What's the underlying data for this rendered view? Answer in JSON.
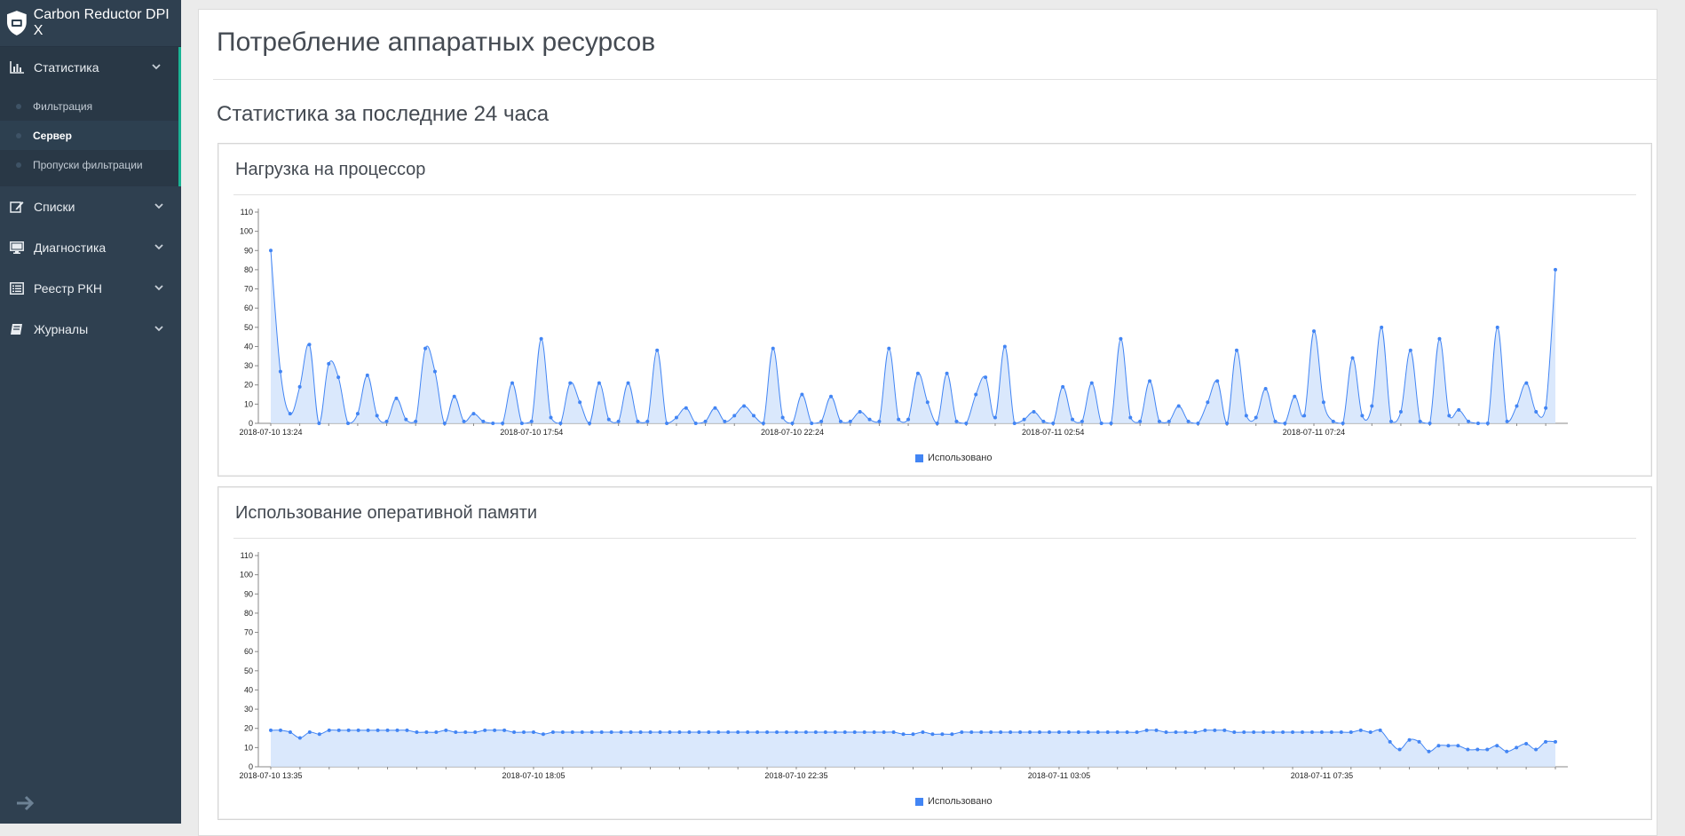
{
  "app": {
    "title": "Carbon Reductor DPI X"
  },
  "sidebar": {
    "items": [
      {
        "label": "Статистика",
        "icon": "bar-chart-icon",
        "expanded": true,
        "children": [
          {
            "label": "Фильтрация"
          },
          {
            "label": "Сервер",
            "current": true
          },
          {
            "label": "Пропуски фильтрации"
          }
        ]
      },
      {
        "label": "Списки",
        "icon": "edit-icon"
      },
      {
        "label": "Диагностика",
        "icon": "monitor-icon"
      },
      {
        "label": "Реестр РКН",
        "icon": "list-icon"
      },
      {
        "label": "Журналы",
        "icon": "book-icon"
      }
    ]
  },
  "page": {
    "title": "Потребление аппаратных ресурсов",
    "section_title": "Статистика за последние 24 часа"
  },
  "colors": {
    "sidebar": "#2f4050",
    "accent": "#1ab394",
    "series": "#4285f4",
    "fill": "#d4e4fb"
  },
  "chart_data": [
    {
      "type": "area",
      "title": "Нагрузка на процессор",
      "ylim": [
        0,
        110
      ],
      "yticks": [
        0,
        10,
        20,
        30,
        40,
        50,
        60,
        70,
        80,
        90,
        100,
        110
      ],
      "xtick_labels": [
        "2018-07-10 13:24",
        "2018-07-10 17:54",
        "2018-07-10 22:24",
        "2018-07-11 02:54",
        "2018-07-11 07:24"
      ],
      "xtick_index": [
        0,
        27,
        54,
        81,
        108
      ],
      "grid": false,
      "legend_position": "bottom",
      "series": [
        {
          "name": "Использовано",
          "values": [
            90,
            27,
            5,
            19,
            41,
            0,
            31,
            24,
            0,
            5,
            25,
            4,
            1,
            13,
            2,
            1,
            39,
            27,
            0,
            14,
            1,
            5,
            1,
            0,
            0,
            21,
            0,
            1,
            44,
            3,
            0,
            21,
            11,
            0,
            21,
            2,
            1,
            21,
            1,
            1,
            38,
            0,
            3,
            8,
            0,
            1,
            8,
            1,
            4,
            9,
            4,
            0,
            39,
            3,
            0,
            15,
            0,
            1,
            14,
            1,
            1,
            6,
            2,
            1,
            39,
            2,
            2,
            26,
            11,
            0,
            26,
            1,
            0,
            15,
            24,
            3,
            40,
            0,
            2,
            6,
            1,
            0,
            19,
            2,
            1,
            21,
            0,
            0,
            44,
            3,
            1,
            22,
            1,
            1,
            9,
            1,
            0,
            11,
            22,
            0,
            38,
            4,
            3,
            18,
            1,
            0,
            14,
            4,
            48,
            11,
            1,
            0,
            34,
            4,
            9,
            50,
            1,
            6,
            38,
            1,
            0,
            44,
            4,
            7,
            1,
            0,
            0,
            50,
            1,
            9,
            21,
            6,
            8,
            80
          ]
        }
      ]
    },
    {
      "type": "area",
      "title": "Использование оперативной памяти",
      "ylim": [
        0,
        110
      ],
      "yticks": [
        0,
        10,
        20,
        30,
        40,
        50,
        60,
        70,
        80,
        90,
        100,
        110
      ],
      "xtick_labels": [
        "2018-07-10 13:35",
        "2018-07-10 18:05",
        "2018-07-10 22:35",
        "2018-07-11 03:05",
        "2018-07-11 07:35"
      ],
      "xtick_index": [
        0,
        27,
        54,
        81,
        108
      ],
      "grid": false,
      "legend_position": "bottom",
      "series": [
        {
          "name": "Использовано",
          "values": [
            19,
            19,
            18,
            15,
            18,
            17,
            19,
            19,
            19,
            19,
            19,
            19,
            19,
            19,
            19,
            18,
            18,
            18,
            19,
            18,
            18,
            18,
            19,
            19,
            19,
            18,
            18,
            18,
            17,
            18,
            18,
            18,
            18,
            18,
            18,
            18,
            18,
            18,
            18,
            18,
            18,
            18,
            18,
            18,
            18,
            18,
            18,
            18,
            18,
            18,
            18,
            18,
            18,
            18,
            18,
            18,
            18,
            18,
            18,
            18,
            18,
            18,
            18,
            18,
            18,
            17,
            17,
            18,
            17,
            17,
            17,
            18,
            18,
            18,
            18,
            18,
            18,
            18,
            18,
            18,
            18,
            18,
            18,
            18,
            18,
            18,
            18,
            18,
            18,
            18,
            19,
            19,
            18,
            18,
            18,
            18,
            19,
            19,
            19,
            18,
            18,
            18,
            18,
            18,
            18,
            18,
            18,
            18,
            18,
            18,
            18,
            18,
            19,
            18,
            19,
            13,
            9,
            14,
            13,
            8,
            11,
            11,
            11,
            9,
            9,
            9,
            11,
            8,
            10,
            12,
            9,
            13,
            13
          ]
        }
      ]
    }
  ]
}
